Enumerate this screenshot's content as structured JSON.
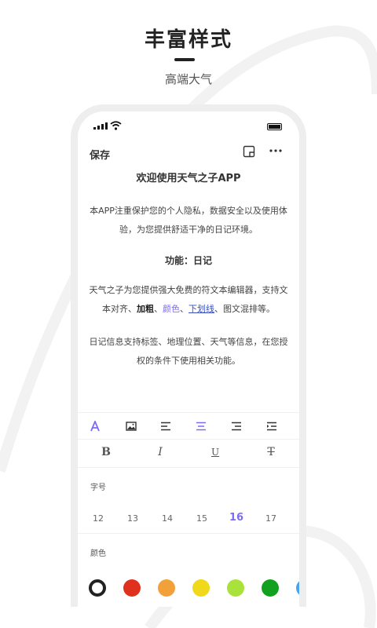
{
  "promo": {
    "title": "丰富样式",
    "subtitle": "高端大气"
  },
  "toolbar": {
    "save_label": "保存"
  },
  "document": {
    "title": "欢迎使用天气之子APP",
    "para1": "本APP注重保护您的个人隐私，数据安全以及使用体验，为您提供舒适干净的日记环境。",
    "subtitle": "功能：日记",
    "para2_pre": "天气之子为您提供强大免费的符文本编辑器，支持文本对齐、",
    "para2_bold": "加粗",
    "para2_sep1": "、",
    "para2_color": "颜色",
    "para2_sep2": "、",
    "para2_underline": "下划线",
    "para2_post": "、图文混排等。",
    "para3": "日记信息支持标签、地理位置、天气等信息，在您授权的条件下使用相关功能。"
  },
  "format_toolbar": {
    "items": [
      "text-color",
      "insert-image",
      "align-left",
      "align-center",
      "align-right",
      "indent"
    ],
    "accent_color": "#7b6cf6"
  },
  "style_toolbar": {
    "bold": "B",
    "italic": "I",
    "underline": "U",
    "strikethrough": "T"
  },
  "font_size": {
    "label": "字号",
    "options": [
      "12",
      "13",
      "14",
      "15",
      "16",
      "17"
    ],
    "selected": "16"
  },
  "colors": {
    "label": "颜色",
    "swatches": [
      "#222222",
      "#e0301e",
      "#f2a13a",
      "#f0d81a",
      "#a8e23a",
      "#12a11e"
    ]
  }
}
